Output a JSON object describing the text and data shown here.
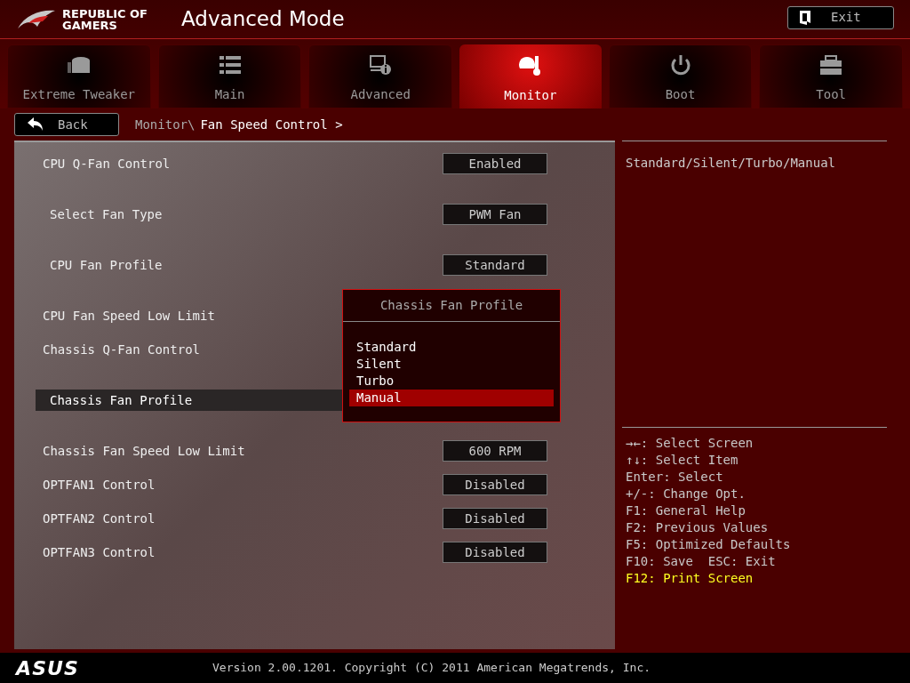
{
  "header": {
    "logo_line_1": "REPUBLIC OF",
    "logo_line_2": "GAMERS",
    "title": "Advanced Mode",
    "exit_button": "Exit"
  },
  "tabs": [
    {
      "label": "Extreme Tweaker",
      "selected": false
    },
    {
      "label": "Main",
      "selected": false
    },
    {
      "label": "Advanced",
      "selected": false
    },
    {
      "label": "Monitor",
      "selected": true
    },
    {
      "label": "Boot",
      "selected": false
    },
    {
      "label": "Tool",
      "selected": false
    }
  ],
  "back_button": "Back",
  "breadcrumb": {
    "parent": "Monitor\\",
    "current": "Fan Speed Control >"
  },
  "settings": [
    {
      "label": "CPU Q-Fan Control",
      "kind": "main",
      "value": "Enabled",
      "selected": false
    },
    {
      "label": "Select Fan Type",
      "kind": "sub",
      "value": "PWM Fan",
      "selected": false
    },
    {
      "label": "CPU Fan Profile",
      "kind": "sub",
      "value": "Standard",
      "selected": false
    },
    {
      "label": "CPU Fan Speed Low Limit",
      "kind": "main",
      "selected": false
    },
    {
      "label": "Chassis Q-Fan Control",
      "kind": "main",
      "selected": false
    },
    {
      "label": "Chassis Fan Profile",
      "kind": "sub",
      "selected": true
    },
    {
      "label": "Chassis Fan Speed Low Limit",
      "kind": "main",
      "value": "600 RPM",
      "selected": false
    },
    {
      "label": "OPTFAN1 Control",
      "kind": "main",
      "value": "Disabled",
      "selected": false
    },
    {
      "label": "OPTFAN2 Control",
      "kind": "main",
      "value": "Disabled",
      "selected": false
    },
    {
      "label": "OPTFAN3 Control",
      "kind": "main",
      "value": "Disabled",
      "selected": false
    }
  ],
  "popup": {
    "title": "Chassis Fan Profile",
    "options": [
      {
        "label": "Standard",
        "selected": false
      },
      {
        "label": "Silent",
        "selected": false
      },
      {
        "label": "Turbo",
        "selected": false
      },
      {
        "label": "Manual",
        "selected": true
      }
    ]
  },
  "help_text": "Standard/Silent/Turbo/Manual",
  "key_help": [
    {
      "text": "→←: Select Screen",
      "kind": "normal"
    },
    {
      "text": "↑↓: Select Item",
      "kind": "normal"
    },
    {
      "text": "Enter: Select",
      "kind": "normal"
    },
    {
      "text": "+/-: Change Opt.",
      "kind": "normal"
    },
    {
      "text": "F1: General Help",
      "kind": "normal"
    },
    {
      "text": "F2: Previous Values",
      "kind": "normal"
    },
    {
      "text": "F5: Optimized Defaults",
      "kind": "normal"
    },
    {
      "text": "F10: Save  ESC: Exit",
      "kind": "normal"
    },
    {
      "text": "F12: Print Screen",
      "kind": "highlight"
    }
  ],
  "footer": {
    "brand": "ASUS",
    "version": "Version 2.00.1201. Copyright (C) 2011 American Megatrends, Inc."
  }
}
